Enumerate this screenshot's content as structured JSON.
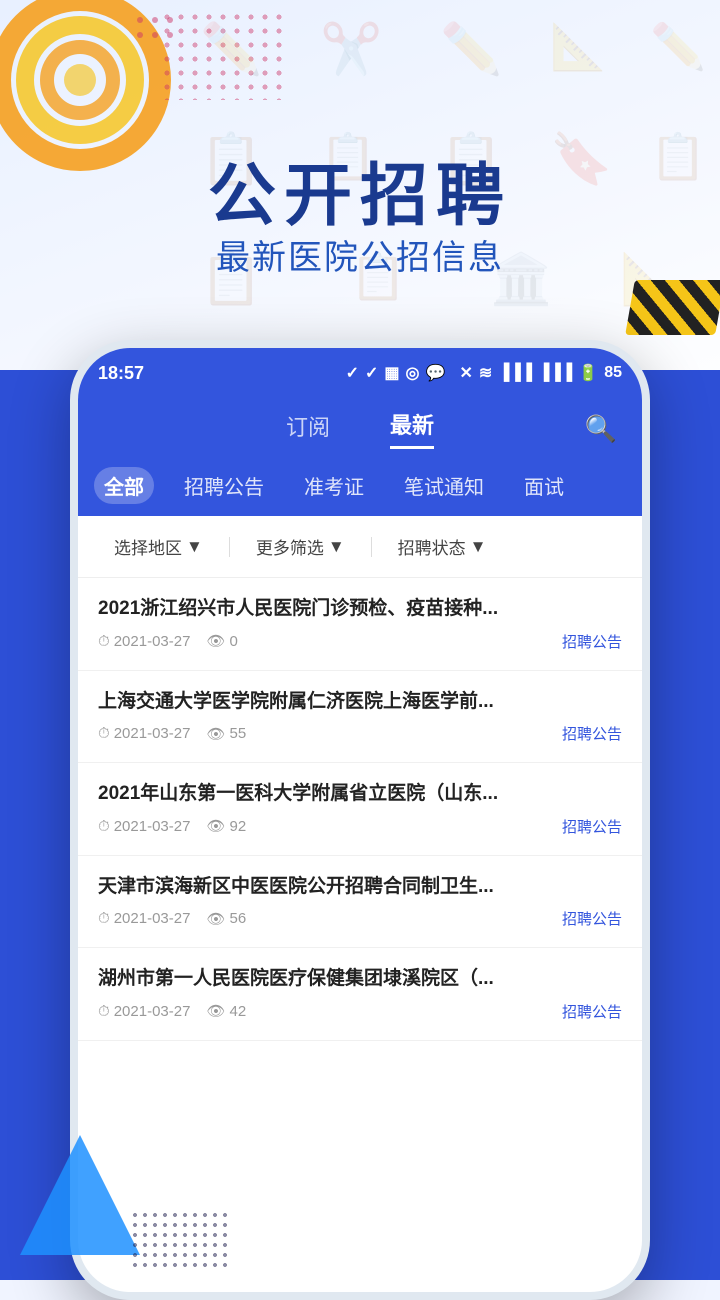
{
  "banner": {
    "main_title": "公开招聘",
    "sub_title": "最新医院公招信息"
  },
  "status_bar": {
    "time": "18:57",
    "battery": "85"
  },
  "nav": {
    "tabs": [
      {
        "label": "订阅",
        "active": false
      },
      {
        "label": "最新",
        "active": true
      }
    ],
    "search_icon": "🔍"
  },
  "categories": [
    {
      "label": "全部",
      "active": true
    },
    {
      "label": "招聘公告",
      "active": false
    },
    {
      "label": "准考证",
      "active": false
    },
    {
      "label": "笔试通知",
      "active": false
    },
    {
      "label": "面试",
      "active": false
    }
  ],
  "filters": [
    {
      "label": "选择地区",
      "icon": "▼"
    },
    {
      "label": "更多筛选",
      "icon": "▼"
    },
    {
      "label": "招聘状态",
      "icon": "▼"
    }
  ],
  "articles": [
    {
      "title": "2021浙江绍兴市人民医院门诊预检、疫苗接种...",
      "date": "2021-03-27",
      "views": "0",
      "tag": "招聘公告"
    },
    {
      "title": "上海交通大学医学院附属仁济医院上海医学前...",
      "date": "2021-03-27",
      "views": "55",
      "tag": "招聘公告"
    },
    {
      "title": "2021年山东第一医科大学附属省立医院（山东...",
      "date": "2021-03-27",
      "views": "92",
      "tag": "招聘公告"
    },
    {
      "title": "天津市滨海新区中医医院公开招聘合同制卫生...",
      "date": "2021-03-27",
      "views": "56",
      "tag": "招聘公告"
    },
    {
      "title": "湖州市第一人民医院医疗保健集团埭溪院区（...",
      "date": "2021-03-27",
      "views": "42",
      "tag": "招聘公告"
    }
  ],
  "colors": {
    "brand_blue": "#3355dd",
    "tag_blue": "#3355dd",
    "title_dark_blue": "#1a3a8f"
  }
}
